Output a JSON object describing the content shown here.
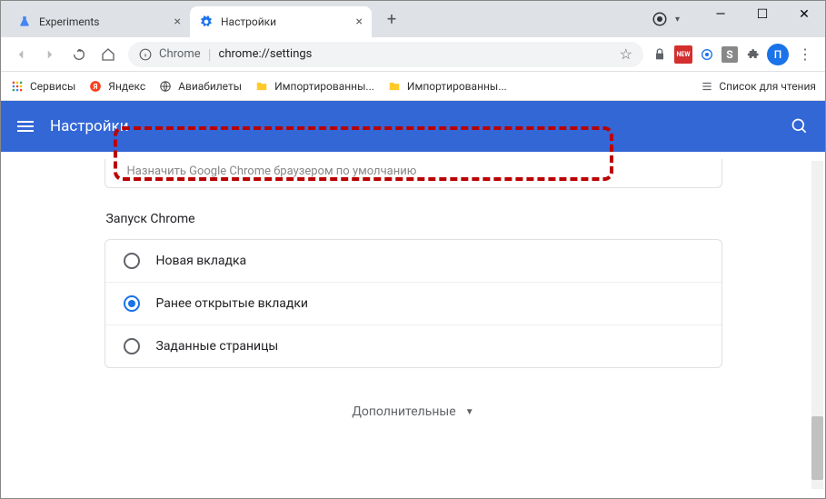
{
  "window": {
    "minimize": "—",
    "maximize": "☐",
    "close": "✕"
  },
  "tabs": [
    {
      "title": "Experiments",
      "icon": "flask"
    },
    {
      "title": "Настройки",
      "icon": "gear",
      "active": true
    }
  ],
  "new_tab": "+",
  "toolbar": {
    "chrome_label": "Chrome",
    "url": "chrome://settings"
  },
  "bookmarks": [
    {
      "label": "Сервисы",
      "icon": "apps"
    },
    {
      "label": "Яндекс",
      "icon": "yandex"
    },
    {
      "label": "Авиабилеты",
      "icon": "globe"
    },
    {
      "label": "Импортированны...",
      "icon": "folder"
    },
    {
      "label": "Импортированны...",
      "icon": "folder"
    }
  ],
  "reading_list": "Список для чтения",
  "settings": {
    "title": "Настройки",
    "default_browser_text": "Назначить Google Chrome браузером по умолчанию",
    "startup_section": "Запуск Chrome",
    "options": [
      {
        "label": "Новая вкладка",
        "selected": false
      },
      {
        "label": "Ранее открытые вкладки",
        "selected": true
      },
      {
        "label": "Заданные страницы",
        "selected": false
      }
    ],
    "advanced": "Дополнительные"
  },
  "profile_letter": "П"
}
